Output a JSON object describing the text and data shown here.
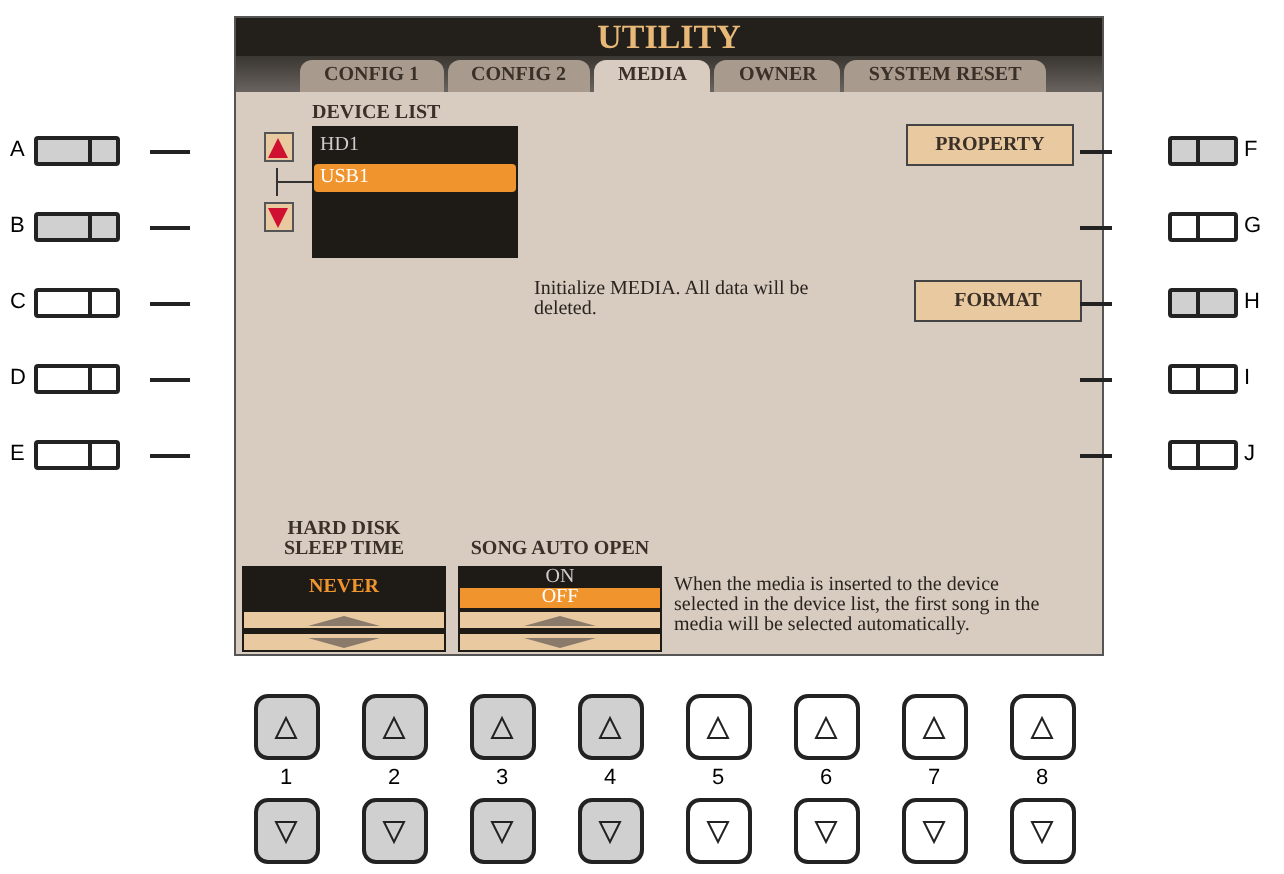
{
  "screen": {
    "title": "UTILITY",
    "tabs": [
      {
        "label": "CONFIG 1",
        "selected": false
      },
      {
        "label": "CONFIG 2",
        "selected": false
      },
      {
        "label": "MEDIA",
        "selected": true
      },
      {
        "label": "OWNER",
        "selected": false
      },
      {
        "label": "SYSTEM RESET",
        "selected": false
      }
    ],
    "device_list": {
      "label": "DEVICE LIST",
      "items": [
        {
          "label": "HD1",
          "selected": false
        },
        {
          "label": "USB1",
          "selected": true
        }
      ]
    },
    "property_button": "PROPERTY",
    "format": {
      "description": "Initialize MEDIA. All data will be deleted.",
      "button": "FORMAT"
    },
    "sleep_time": {
      "label": "HARD DISK\nSLEEP TIME",
      "value": "NEVER"
    },
    "song_auto_open": {
      "label": "SONG AUTO OPEN",
      "options": [
        {
          "label": "ON",
          "selected": false
        },
        {
          "label": "OFF",
          "selected": true
        }
      ]
    },
    "song_auto_open_help": "When the media is inserted to the device selected in the device list, the first song in the media will be selected automatically."
  },
  "left_buttons": [
    {
      "label": "A",
      "active": true
    },
    {
      "label": "B",
      "active": true
    },
    {
      "label": "C",
      "active": false
    },
    {
      "label": "D",
      "active": false
    },
    {
      "label": "E",
      "active": false
    }
  ],
  "right_buttons": [
    {
      "label": "F",
      "active": true
    },
    {
      "label": "G",
      "active": false
    },
    {
      "label": "H",
      "active": true
    },
    {
      "label": "I",
      "active": false
    },
    {
      "label": "J",
      "active": false
    }
  ],
  "bottom_buttons": [
    {
      "label": "1",
      "active": true
    },
    {
      "label": "2",
      "active": true
    },
    {
      "label": "3",
      "active": true
    },
    {
      "label": "4",
      "active": true
    },
    {
      "label": "5",
      "active": false
    },
    {
      "label": "6",
      "active": false
    },
    {
      "label": "7",
      "active": false
    },
    {
      "label": "8",
      "active": false
    }
  ]
}
